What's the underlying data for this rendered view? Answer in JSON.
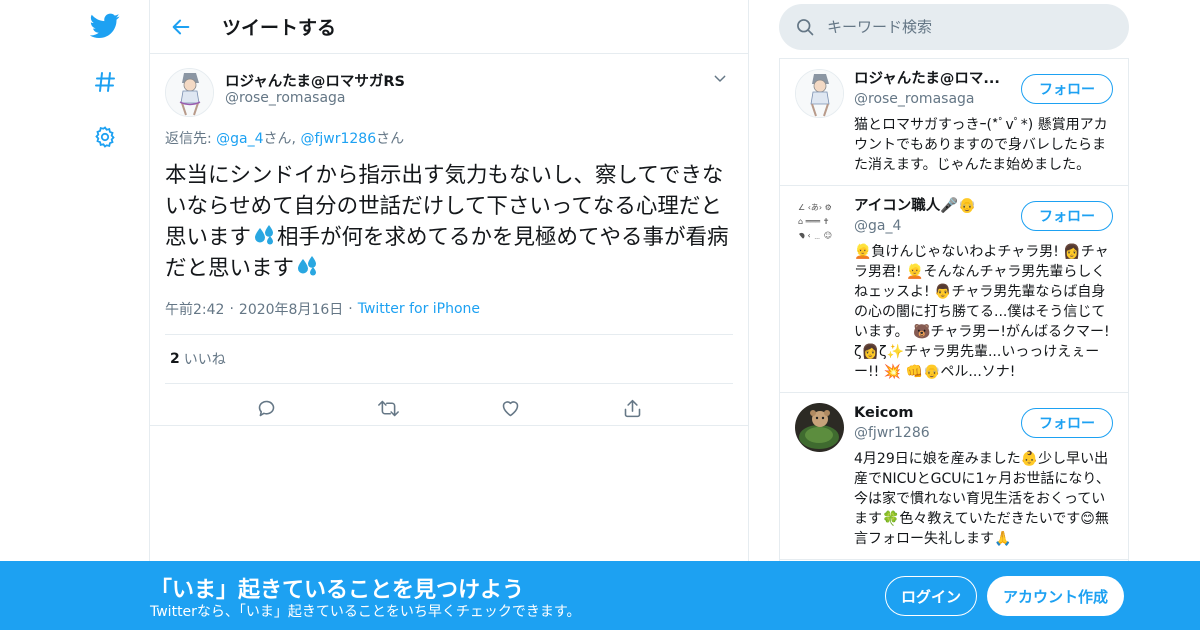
{
  "colors": {
    "brand": "#1da1f2",
    "text": "#14171a",
    "muted": "#657786",
    "border": "#e6ecf0"
  },
  "nav": {
    "logo_icon": "twitter-bird-icon",
    "explore_icon": "hashtag-icon",
    "settings_icon": "gear-icon"
  },
  "header": {
    "title": "ツイートする",
    "back_icon": "arrow-left-icon"
  },
  "tweet": {
    "author_name": "ロジャんたま@ロマサガRS",
    "author_handle": "@rose_romasaga",
    "reply_prefix": "返信先: ",
    "reply_users": [
      "@ga_4",
      "@fjwr1286"
    ],
    "reply_suffix": "さん",
    "reply_sep": ", ",
    "text_part1": "本当にシンドイから指示出す気力もないし、察してできないならせめて自分の世話だけして下さいってなる心理だと思います",
    "text_part2": "相手が何を求めてるかを見極めてやる事が看病だと思います",
    "time": "午前2:42",
    "date": "2020年8月16日",
    "source": "Twitter for iPhone",
    "likes_count": "2",
    "likes_label": "いいね"
  },
  "search": {
    "placeholder": "キーワード検索"
  },
  "users": [
    {
      "name": "ロジャんたま@ロマ...",
      "handle": "@rose_romasaga",
      "bio": "猫とロマサガすっきｰ(*ﾟvﾟ*) 懸賞用アカウントでもありますので身バレしたらまた消えます。じゃんたま始めました。",
      "follow_label": "フォロー"
    },
    {
      "name": "アイコン職人🎤👴",
      "handle": "@ga_4",
      "bio": "👱負けんじゃないわよチャラ男! 👩チャラ男君! 👱そんなんチャラ男先輩らしくねェッスよ! 👨チャラ男先輩ならば自身の心の闇に打ち勝てる...僕はそう信じています。 🐻チャラ男ー!がんばるクマー! ζ👩ζ✨チャラ男先輩...いっっけえぇーー!! 💥 👊👴ペル...ソナ!",
      "follow_label": "フォロー"
    },
    {
      "name": "Keicom",
      "handle": "@fjwr1286",
      "bio": "4月29日に娘を産みました👶少し早い出産でNICUとGCUに1ヶ月お世話になり、今は家で慣れない育児生活をおくっています🍀色々教えていただきたいです😊無言フォロー失礼します🙏",
      "follow_label": "フォロー"
    }
  ],
  "bottom_bar": {
    "title": "「いま」起きていることを見つけよう",
    "subtitle": "Twitterなら、「いま」起きていることをいち早くチェックできます。",
    "login_label": "ログイン",
    "signup_label": "アカウント作成"
  }
}
